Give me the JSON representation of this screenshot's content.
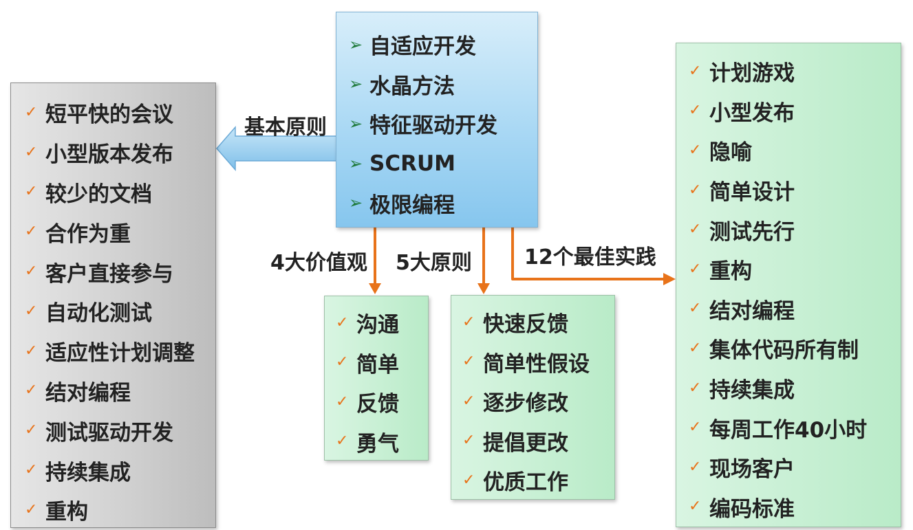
{
  "center": {
    "items": [
      "自适应开发",
      "水晶方法",
      "特征驱动开发",
      "SCRUM",
      "极限编程"
    ],
    "bullet_icon": "chevron-right-icon",
    "gradient_colors": [
      "#d8eefa",
      "#86c6ee"
    ]
  },
  "left": {
    "items": [
      "短平快的会议",
      "小型版本发布",
      "较少的文档",
      "合作为重",
      "客户直接参与",
      "自动化测试",
      "适应性计划调整",
      "结对编程",
      "测试驱动开发",
      "持续集成",
      "重构"
    ],
    "bullet_icon": "checkmark-icon",
    "gradient_colors": [
      "#e6e6e6",
      "#bdbdbd"
    ]
  },
  "values": {
    "items": [
      "沟通",
      "简单",
      "反馈",
      "勇气"
    ]
  },
  "principles": {
    "items": [
      "快速反馈",
      "简单性假设",
      "逐步修改",
      "提倡更改",
      "优质工作"
    ]
  },
  "practices": {
    "items": [
      "计划游戏",
      "小型发布",
      "隐喻",
      "简单设计",
      "测试先行",
      "重构",
      "结对编程",
      "集体代码所有制",
      "持续集成",
      "每周工作40小时",
      "现场客户",
      "编码标准"
    ]
  },
  "labels": {
    "basic": "基本原则",
    "values": "4大价值观",
    "principles": "5大原则",
    "practices": "12个最佳实践"
  },
  "colors": {
    "check": "#e8731a",
    "connector": "#e8731a",
    "block_arrow": "#8cc6ec",
    "chevron": "#1e7a3a",
    "green_box": "#c6f0d2"
  }
}
